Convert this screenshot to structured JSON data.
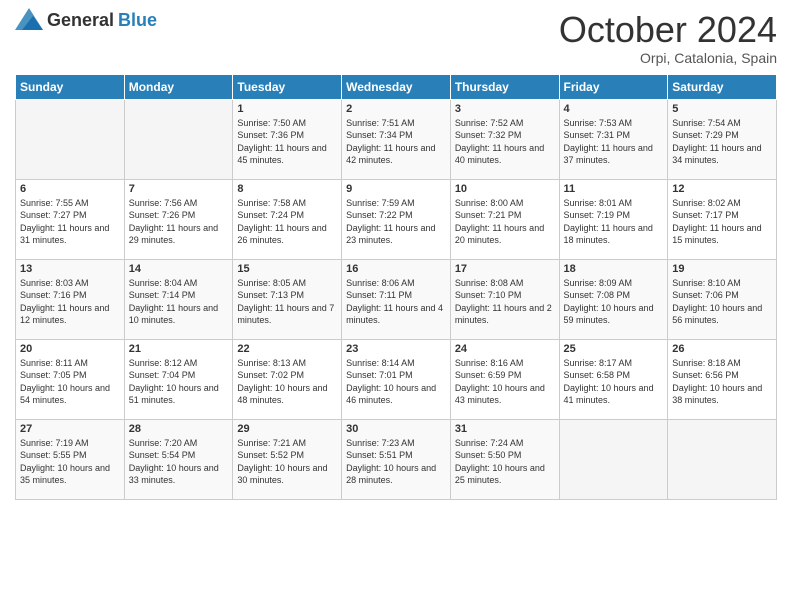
{
  "logo": {
    "general": "General",
    "blue": "Blue"
  },
  "title": {
    "month_year": "October 2024",
    "location": "Orpi, Catalonia, Spain"
  },
  "weekdays": [
    "Sunday",
    "Monday",
    "Tuesday",
    "Wednesday",
    "Thursday",
    "Friday",
    "Saturday"
  ],
  "weeks": [
    [
      {
        "day": "",
        "sunrise": "",
        "sunset": "",
        "daylight": ""
      },
      {
        "day": "",
        "sunrise": "",
        "sunset": "",
        "daylight": ""
      },
      {
        "day": "1",
        "sunrise": "Sunrise: 7:50 AM",
        "sunset": "Sunset: 7:36 PM",
        "daylight": "Daylight: 11 hours and 45 minutes."
      },
      {
        "day": "2",
        "sunrise": "Sunrise: 7:51 AM",
        "sunset": "Sunset: 7:34 PM",
        "daylight": "Daylight: 11 hours and 42 minutes."
      },
      {
        "day": "3",
        "sunrise": "Sunrise: 7:52 AM",
        "sunset": "Sunset: 7:32 PM",
        "daylight": "Daylight: 11 hours and 40 minutes."
      },
      {
        "day": "4",
        "sunrise": "Sunrise: 7:53 AM",
        "sunset": "Sunset: 7:31 PM",
        "daylight": "Daylight: 11 hours and 37 minutes."
      },
      {
        "day": "5",
        "sunrise": "Sunrise: 7:54 AM",
        "sunset": "Sunset: 7:29 PM",
        "daylight": "Daylight: 11 hours and 34 minutes."
      }
    ],
    [
      {
        "day": "6",
        "sunrise": "Sunrise: 7:55 AM",
        "sunset": "Sunset: 7:27 PM",
        "daylight": "Daylight: 11 hours and 31 minutes."
      },
      {
        "day": "7",
        "sunrise": "Sunrise: 7:56 AM",
        "sunset": "Sunset: 7:26 PM",
        "daylight": "Daylight: 11 hours and 29 minutes."
      },
      {
        "day": "8",
        "sunrise": "Sunrise: 7:58 AM",
        "sunset": "Sunset: 7:24 PM",
        "daylight": "Daylight: 11 hours and 26 minutes."
      },
      {
        "day": "9",
        "sunrise": "Sunrise: 7:59 AM",
        "sunset": "Sunset: 7:22 PM",
        "daylight": "Daylight: 11 hours and 23 minutes."
      },
      {
        "day": "10",
        "sunrise": "Sunrise: 8:00 AM",
        "sunset": "Sunset: 7:21 PM",
        "daylight": "Daylight: 11 hours and 20 minutes."
      },
      {
        "day": "11",
        "sunrise": "Sunrise: 8:01 AM",
        "sunset": "Sunset: 7:19 PM",
        "daylight": "Daylight: 11 hours and 18 minutes."
      },
      {
        "day": "12",
        "sunrise": "Sunrise: 8:02 AM",
        "sunset": "Sunset: 7:17 PM",
        "daylight": "Daylight: 11 hours and 15 minutes."
      }
    ],
    [
      {
        "day": "13",
        "sunrise": "Sunrise: 8:03 AM",
        "sunset": "Sunset: 7:16 PM",
        "daylight": "Daylight: 11 hours and 12 minutes."
      },
      {
        "day": "14",
        "sunrise": "Sunrise: 8:04 AM",
        "sunset": "Sunset: 7:14 PM",
        "daylight": "Daylight: 11 hours and 10 minutes."
      },
      {
        "day": "15",
        "sunrise": "Sunrise: 8:05 AM",
        "sunset": "Sunset: 7:13 PM",
        "daylight": "Daylight: 11 hours and 7 minutes."
      },
      {
        "day": "16",
        "sunrise": "Sunrise: 8:06 AM",
        "sunset": "Sunset: 7:11 PM",
        "daylight": "Daylight: 11 hours and 4 minutes."
      },
      {
        "day": "17",
        "sunrise": "Sunrise: 8:08 AM",
        "sunset": "Sunset: 7:10 PM",
        "daylight": "Daylight: 11 hours and 2 minutes."
      },
      {
        "day": "18",
        "sunrise": "Sunrise: 8:09 AM",
        "sunset": "Sunset: 7:08 PM",
        "daylight": "Daylight: 10 hours and 59 minutes."
      },
      {
        "day": "19",
        "sunrise": "Sunrise: 8:10 AM",
        "sunset": "Sunset: 7:06 PM",
        "daylight": "Daylight: 10 hours and 56 minutes."
      }
    ],
    [
      {
        "day": "20",
        "sunrise": "Sunrise: 8:11 AM",
        "sunset": "Sunset: 7:05 PM",
        "daylight": "Daylight: 10 hours and 54 minutes."
      },
      {
        "day": "21",
        "sunrise": "Sunrise: 8:12 AM",
        "sunset": "Sunset: 7:04 PM",
        "daylight": "Daylight: 10 hours and 51 minutes."
      },
      {
        "day": "22",
        "sunrise": "Sunrise: 8:13 AM",
        "sunset": "Sunset: 7:02 PM",
        "daylight": "Daylight: 10 hours and 48 minutes."
      },
      {
        "day": "23",
        "sunrise": "Sunrise: 8:14 AM",
        "sunset": "Sunset: 7:01 PM",
        "daylight": "Daylight: 10 hours and 46 minutes."
      },
      {
        "day": "24",
        "sunrise": "Sunrise: 8:16 AM",
        "sunset": "Sunset: 6:59 PM",
        "daylight": "Daylight: 10 hours and 43 minutes."
      },
      {
        "day": "25",
        "sunrise": "Sunrise: 8:17 AM",
        "sunset": "Sunset: 6:58 PM",
        "daylight": "Daylight: 10 hours and 41 minutes."
      },
      {
        "day": "26",
        "sunrise": "Sunrise: 8:18 AM",
        "sunset": "Sunset: 6:56 PM",
        "daylight": "Daylight: 10 hours and 38 minutes."
      }
    ],
    [
      {
        "day": "27",
        "sunrise": "Sunrise: 7:19 AM",
        "sunset": "Sunset: 5:55 PM",
        "daylight": "Daylight: 10 hours and 35 minutes."
      },
      {
        "day": "28",
        "sunrise": "Sunrise: 7:20 AM",
        "sunset": "Sunset: 5:54 PM",
        "daylight": "Daylight: 10 hours and 33 minutes."
      },
      {
        "day": "29",
        "sunrise": "Sunrise: 7:21 AM",
        "sunset": "Sunset: 5:52 PM",
        "daylight": "Daylight: 10 hours and 30 minutes."
      },
      {
        "day": "30",
        "sunrise": "Sunrise: 7:23 AM",
        "sunset": "Sunset: 5:51 PM",
        "daylight": "Daylight: 10 hours and 28 minutes."
      },
      {
        "day": "31",
        "sunrise": "Sunrise: 7:24 AM",
        "sunset": "Sunset: 5:50 PM",
        "daylight": "Daylight: 10 hours and 25 minutes."
      },
      {
        "day": "",
        "sunrise": "",
        "sunset": "",
        "daylight": ""
      },
      {
        "day": "",
        "sunrise": "",
        "sunset": "",
        "daylight": ""
      }
    ]
  ]
}
